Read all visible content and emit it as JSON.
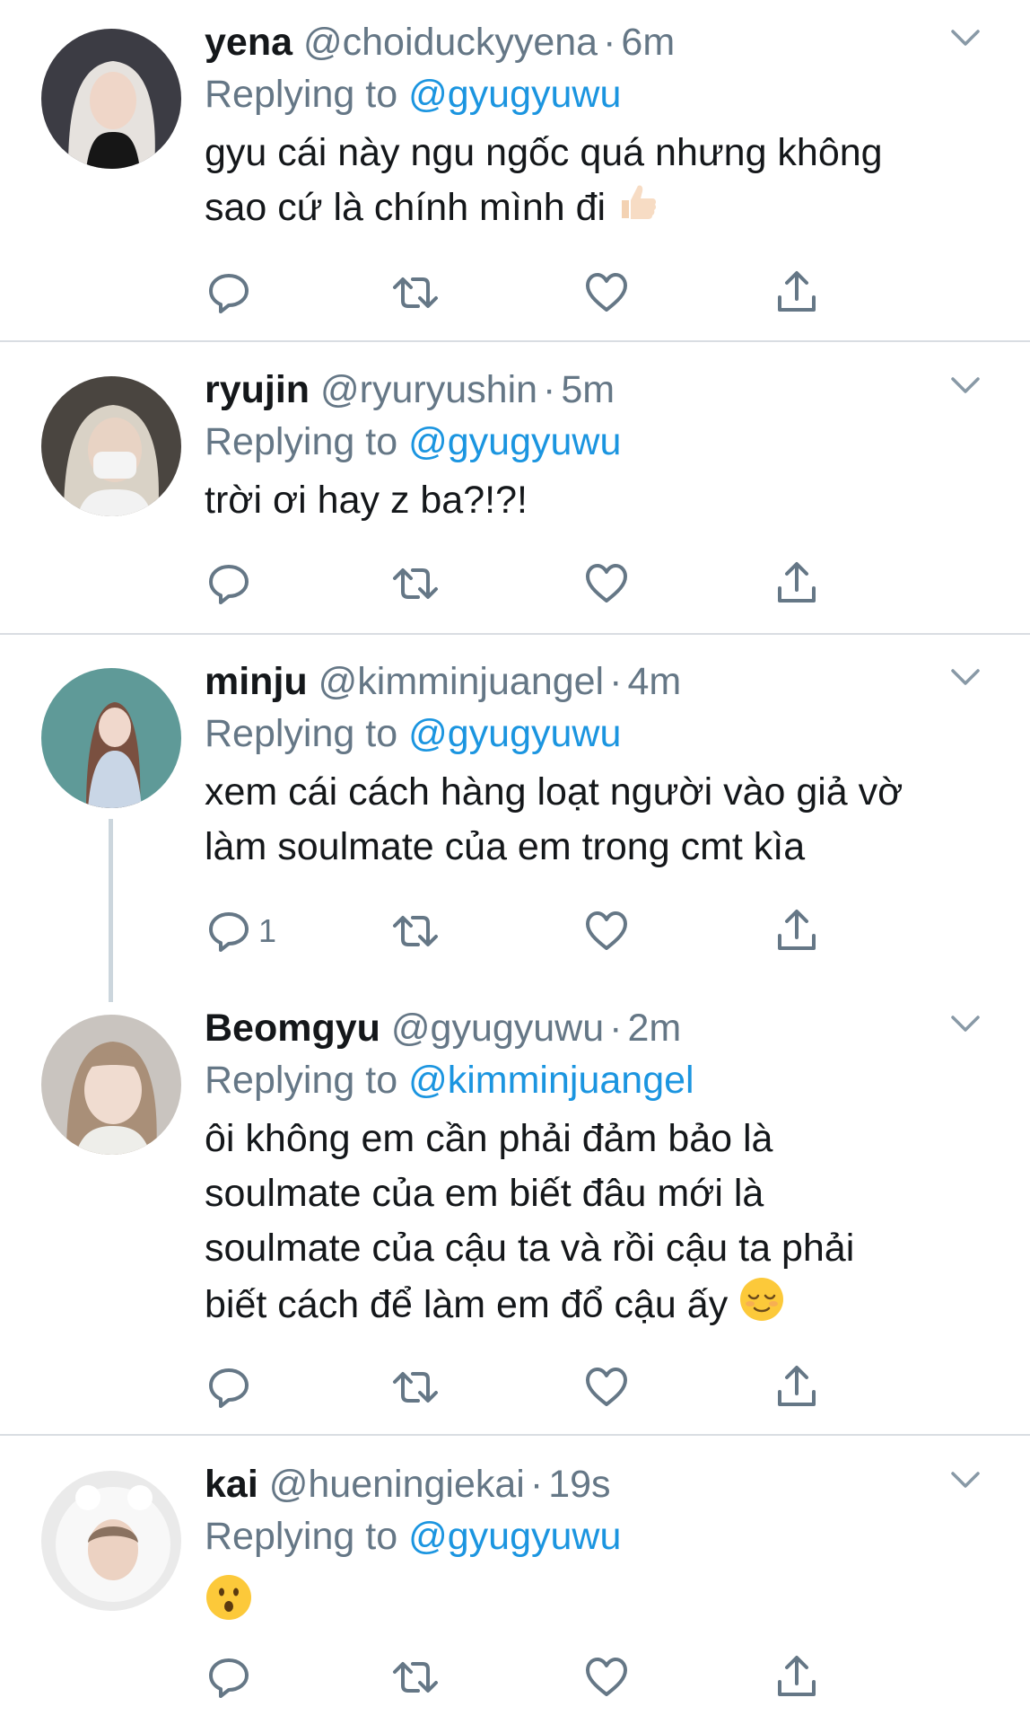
{
  "colors": {
    "link": "#1b95e0",
    "secondary": "#657786",
    "text": "#14171a",
    "divider": "#d9dde2"
  },
  "tweets": [
    {
      "name": "yena",
      "handle": "@choiduckyyena",
      "time": "6m",
      "replying_label": "Replying to",
      "replying_to": "@gyugyuwu",
      "text_lines": [
        "gyu cái này ngu ngốc quá nhưng không",
        "sao cứ là chính mình đi"
      ],
      "emoji": "thumbs-up",
      "reply_count": ""
    },
    {
      "name": "ryujin",
      "handle": "@ryuryushin",
      "time": "5m",
      "replying_label": "Replying to",
      "replying_to": "@gyugyuwu",
      "text_lines": [
        "trời ơi hay z ba?!?!"
      ],
      "reply_count": ""
    },
    {
      "name": "minju",
      "handle": "@kimminjuangel",
      "time": "4m",
      "replying_label": "Replying to",
      "replying_to": "@gyugyuwu",
      "text_lines": [
        "xem cái cách hàng loạt người vào giả vờ",
        "làm soulmate của em trong cmt kìa"
      ],
      "reply_count": "1"
    },
    {
      "name": "Beomgyu",
      "handle": "@gyugyuwu",
      "time": "2m",
      "replying_label": "Replying to",
      "replying_to": "@kimminjuangel",
      "text_lines": [
        "ôi không em cần phải đảm bảo là",
        "soulmate của em biết đâu mới là",
        "soulmate của cậu ta và rồi cậu ta phải",
        "biết cách để làm em đổ cậu ấy"
      ],
      "emoji": "relieved-face",
      "reply_count": ""
    },
    {
      "name": "kai",
      "handle": "@hueningiekai",
      "time": "19s",
      "replying_label": "Replying to",
      "replying_to": "@gyugyuwu",
      "text_lines": [],
      "emoji": "hushed-face",
      "reply_count": ""
    }
  ]
}
